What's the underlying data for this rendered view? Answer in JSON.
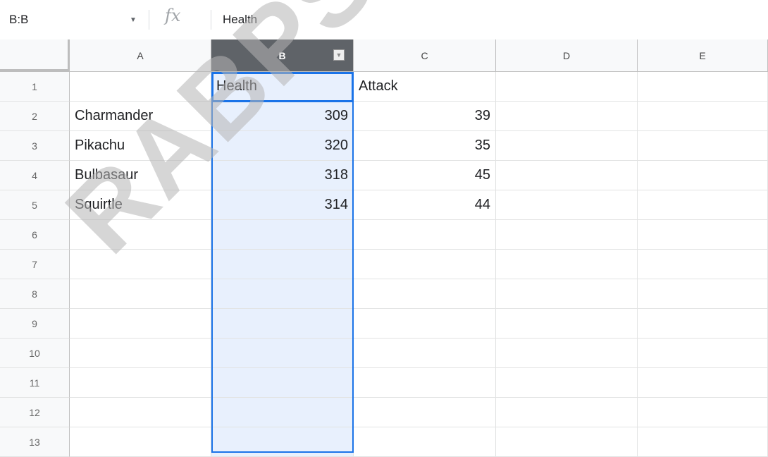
{
  "formula_bar": {
    "name_box": "B:B",
    "fx_label": "fx",
    "value": "Health"
  },
  "columns": [
    "A",
    "B",
    "C",
    "D",
    "E"
  ],
  "selected_column": "B",
  "rows": [
    {
      "num": "1",
      "cells": [
        "",
        "Health",
        "Attack",
        "",
        ""
      ]
    },
    {
      "num": "2",
      "cells": [
        "Charmander",
        "309",
        "39",
        "",
        ""
      ]
    },
    {
      "num": "3",
      "cells": [
        "Pikachu",
        "320",
        "35",
        "",
        ""
      ]
    },
    {
      "num": "4",
      "cells": [
        "Bulbasaur",
        "318",
        "45",
        "",
        ""
      ]
    },
    {
      "num": "5",
      "cells": [
        "Squirtle",
        "314",
        "44",
        "",
        ""
      ]
    },
    {
      "num": "6",
      "cells": [
        "",
        "",
        "",
        "",
        ""
      ]
    },
    {
      "num": "7",
      "cells": [
        "",
        "",
        "",
        "",
        ""
      ]
    },
    {
      "num": "8",
      "cells": [
        "",
        "",
        "",
        "",
        ""
      ]
    },
    {
      "num": "9",
      "cells": [
        "",
        "",
        "",
        "",
        ""
      ]
    },
    {
      "num": "10",
      "cells": [
        "",
        "",
        "",
        "",
        ""
      ]
    },
    {
      "num": "11",
      "cells": [
        "",
        "",
        "",
        "",
        ""
      ]
    },
    {
      "num": "12",
      "cells": [
        "",
        "",
        "",
        "",
        ""
      ]
    },
    {
      "num": "13",
      "cells": [
        "",
        "",
        "",
        "",
        ""
      ]
    }
  ],
  "watermark": "RABPSYCHOLOGY",
  "colors": {
    "selection": "#1a73e8",
    "selection_fill": "#e8f0fd",
    "selected_header": "#5f6368"
  }
}
